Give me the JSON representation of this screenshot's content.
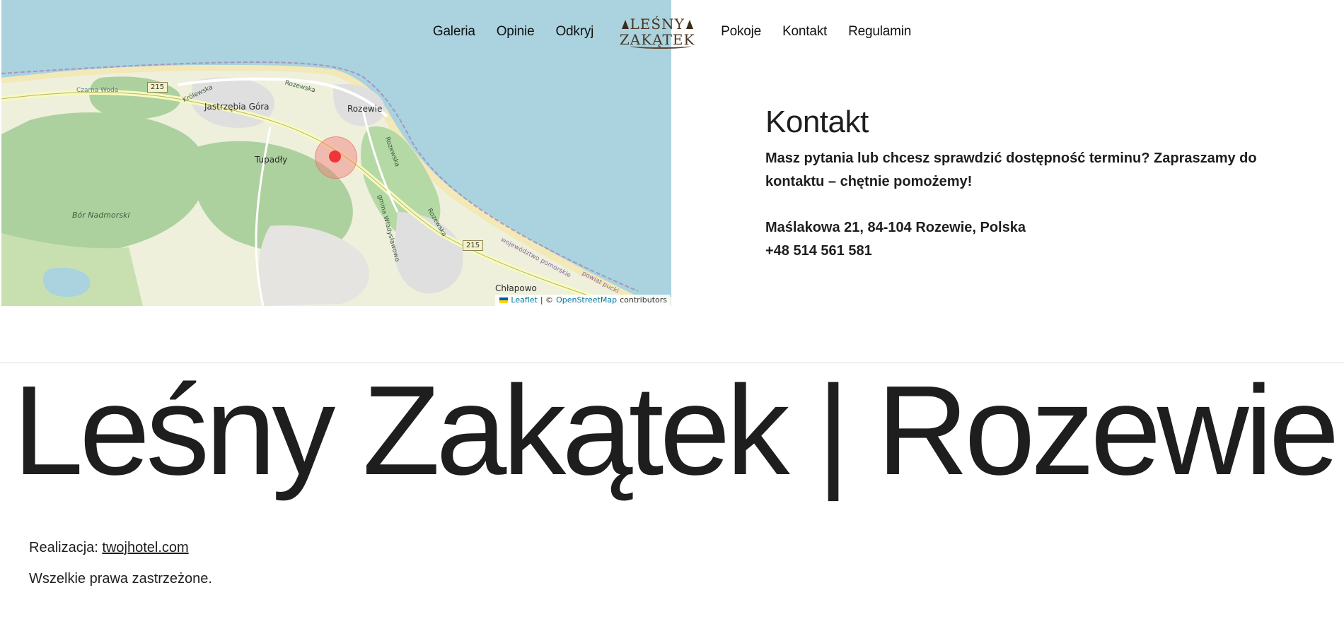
{
  "header": {
    "nav_left": [
      "Galeria",
      "Opinie",
      "Odkryj"
    ],
    "nav_right": [
      "Pokoje",
      "Kontakt",
      "Regulamin"
    ],
    "logo": {
      "line1": "LEŚNY",
      "line2": "ZAKĄTEK"
    }
  },
  "map": {
    "labels": {
      "jastrzebia": "Jastrzębia Góra",
      "rozewie": "Rozewie",
      "tupadly": "Tupadły",
      "bor": "Bór Nadmorski",
      "chlapowo": "Chłapowo",
      "czarna_woda": "Czarna Woda",
      "krolewska": "Królewska",
      "rozewska1": "Rozewska",
      "rozewska2": "Rozewska",
      "rozewska3": "Rozewska",
      "gmina": "gmina Władysławowo",
      "wojewodztwo": "województwo pomorskie",
      "powiat": "powiat pucki"
    },
    "road_215_a": "215",
    "road_215_b": "215",
    "attribution": {
      "leaflet": "Leaflet",
      "sep": "| ©",
      "osm": "OpenStreetMap",
      "contributors": "contributors"
    },
    "colors": {
      "sea": "#aad3df",
      "forest": "#add19e",
      "land": "#f2efe9"
    }
  },
  "contact": {
    "title": "Kontakt",
    "lead": "Masz pytania lub chcesz sprawdzić dostępność terminu? Zapraszamy do kontaktu – chętnie pomożemy!",
    "address": "Maślakowa 21, 84-104 Rozewie, Polska",
    "phone": "+48 514 561 581"
  },
  "footer": {
    "big_title": "Leśny Zakątek | Rozewie",
    "credit_prefix": "Realizacja: ",
    "credit_link": "twojhotel.com",
    "rights": "Wszelkie prawa zastrzeżone."
  }
}
